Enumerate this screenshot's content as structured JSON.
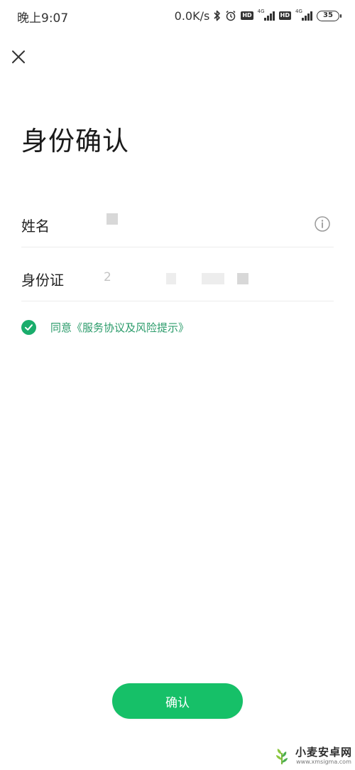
{
  "status_bar": {
    "time": "晚上9:07",
    "net_speed": "0.0K/s",
    "hd_label": "HD",
    "network_label": "4G",
    "battery_level": "35",
    "icons": [
      "bluetooth-icon",
      "alarm-icon",
      "hd-icon",
      "signal-icon",
      "hd-icon",
      "signal-icon",
      "battery-icon"
    ]
  },
  "header": {
    "close_icon": "close-icon",
    "title": "身份确认"
  },
  "form": {
    "name": {
      "label": "姓名",
      "value": ""
    },
    "id_card": {
      "label": "身份证",
      "value": "",
      "partial_char": "2"
    },
    "info_icon": "info-icon"
  },
  "agreement": {
    "checked": true,
    "text": "同意《服务协议及风险提示》"
  },
  "actions": {
    "confirm_label": "确认"
  },
  "watermark": {
    "title": "小麦安卓网",
    "url": "www.xmsigma.com"
  },
  "colors": {
    "accent": "#16c068",
    "link": "#2a9b6a",
    "check": "#1aad6c",
    "text": "#222222",
    "divider": "#ececec"
  }
}
